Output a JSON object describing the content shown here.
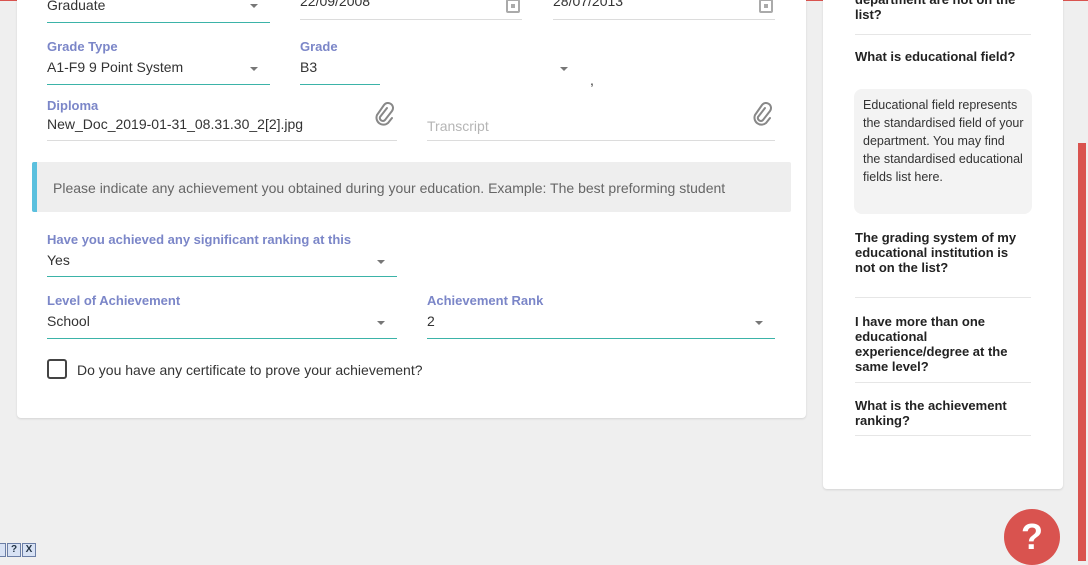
{
  "form": {
    "degree": {
      "value": "Graduate"
    },
    "start_date": {
      "value": "22/09/2008"
    },
    "end_date": {
      "value": "28/07/2013"
    },
    "grade_type": {
      "label": "Grade Type",
      "value": "A1-F9 9 Point System"
    },
    "grade": {
      "label": "Grade",
      "value": "B3"
    },
    "grade_extra": {
      "value": ","
    },
    "diploma": {
      "label": "Diploma",
      "value": "New_Doc_2019-01-31_08.31.30_2[2].jpg"
    },
    "transcript": {
      "placeholder": "Transcript"
    },
    "info_text": "Please indicate any achievement you obtained during your education. Example: The best preforming student",
    "ranking": {
      "label": "Have you achieved any significant ranking at this",
      "value": "Yes"
    },
    "level": {
      "label": "Level of Achievement",
      "value": "School"
    },
    "rank": {
      "label": "Achievement Rank",
      "value": "2"
    },
    "certificate": {
      "label": "Do you have any certificate to prove your achievement?",
      "checked": false
    }
  },
  "faq": {
    "items": [
      {
        "question": "department are not on the list?"
      },
      {
        "question": "What is educational field?"
      },
      {
        "question": "The grading system of my educational institution is not on the list?"
      },
      {
        "question": "I have more than one educational experience/degree at the same level?"
      },
      {
        "question": "What is the achievement ranking?"
      }
    ],
    "answer": "Educational field represents the standardised field of your department. You may find the standardised educational fields list here."
  },
  "help_button": {
    "label": "?"
  },
  "tray": {
    "labels": [
      "?",
      "X"
    ]
  },
  "colors": {
    "accent": "#3bb3a8",
    "label": "#7b86c8",
    "brand_red": "#d9534f",
    "info_border": "#5bc0de"
  }
}
